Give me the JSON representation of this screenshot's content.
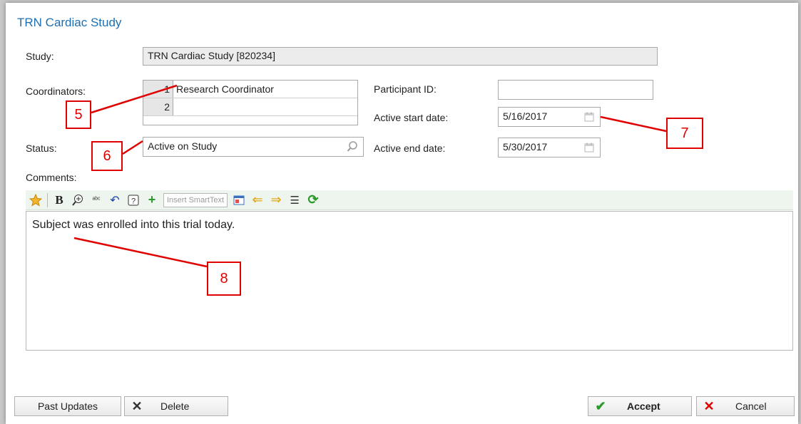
{
  "window": {
    "title": "TRN Cardiac Study"
  },
  "form": {
    "study_label": "Study:",
    "study_value": "TRN Cardiac Study [820234]",
    "coordinators_label": "Coordinators:",
    "coordinators": [
      {
        "num": "1",
        "name": "Research Coordinator"
      },
      {
        "num": "2",
        "name": ""
      }
    ],
    "status_label": "Status:",
    "status_value": "Active on Study",
    "participant_label": "Participant ID:",
    "participant_value": "",
    "start_label": "Active start date:",
    "start_value": "5/16/2017",
    "end_label": "Active end date:",
    "end_value": "5/30/2017",
    "comments_label": "Comments:"
  },
  "toolbar": {
    "smarttext_placeholder": "Insert SmartText"
  },
  "editor": {
    "text": "Subject was enrolled into this trial today."
  },
  "buttons": {
    "past_updates": "Past Updates",
    "delete": "Delete",
    "accept": "Accept",
    "cancel": "Cancel"
  },
  "callouts": {
    "c5": "5",
    "c6": "6",
    "c7": "7",
    "c8": "8"
  },
  "colors": {
    "title": "#1f6fb0",
    "callout": "#e00000",
    "toolbar": "#eef4ee"
  }
}
